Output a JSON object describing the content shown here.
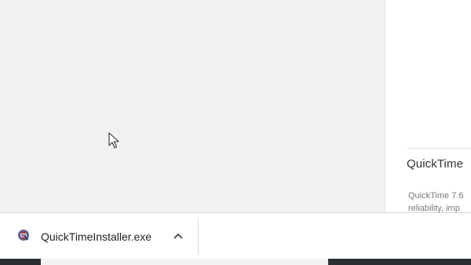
{
  "right_panel": {
    "title": "QuickTime",
    "desc_line1": "QuickTime 7.6",
    "desc_line2": "reliability, imp"
  },
  "download_bar": {
    "file_name": "QuickTimeInstaller.exe",
    "file_icon": "quicktime-installer-icon",
    "expand_icon": "chevron-up-icon"
  },
  "cursor": {
    "icon": "mouse-pointer-icon"
  },
  "colors": {
    "page_bg": "#f1f1f1",
    "panel_bg": "#ffffff",
    "taskbar": "#2b2f33"
  }
}
